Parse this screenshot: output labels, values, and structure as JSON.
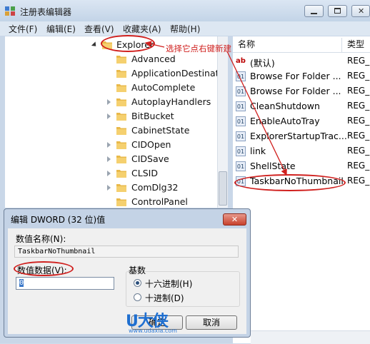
{
  "window": {
    "title": "注册表编辑器"
  },
  "menu": [
    "文件(F)",
    "编辑(E)",
    "查看(V)",
    "收藏夹(A)",
    "帮助(H)"
  ],
  "tree": {
    "selected": "Explorer",
    "items": [
      "Advanced",
      "ApplicationDestinatio",
      "AutoComplete",
      "AutoplayHandlers",
      "BitBucket",
      "CabinetState",
      "CIDOpen",
      "CIDSave",
      "CLSID",
      "ComDlg32",
      "ControlPanel"
    ]
  },
  "values_pane": {
    "columns": {
      "name": "名称",
      "type": "类型"
    },
    "rows": [
      {
        "name": "(默认)",
        "type": "REG_S",
        "icon": "string-value-icon"
      },
      {
        "name": "Browse For Folder ...",
        "type": "REG_D",
        "icon": "binary-value-icon"
      },
      {
        "name": "Browse For Folder ...",
        "type": "REG_D",
        "icon": "binary-value-icon"
      },
      {
        "name": "CleanShutdown",
        "type": "REG_D",
        "icon": "binary-value-icon"
      },
      {
        "name": "EnableAutoTray",
        "type": "REG_D",
        "icon": "binary-value-icon"
      },
      {
        "name": "ExplorerStartupTrac...",
        "type": "REG_D",
        "icon": "binary-value-icon"
      },
      {
        "name": "link",
        "type": "REG_B",
        "icon": "binary-value-icon"
      },
      {
        "name": "ShellState",
        "type": "REG_B",
        "icon": "binary-value-icon"
      },
      {
        "name": "TaskbarNoThumbnail",
        "type": "REG_D",
        "icon": "binary-value-icon"
      }
    ]
  },
  "annotation": "选择它点右键新建",
  "dialog": {
    "title": "编辑 DWORD (32 位)值",
    "name_label": "数值名称(N):",
    "name_value": "TaskbarNoThumbnail",
    "data_label": "数值数据(V):",
    "data_value": "0",
    "base_label": "基数",
    "radio_hex": "十六进制(H)",
    "radio_dec": "十进制(D)",
    "ok_label": "确定",
    "cancel_label": "取消",
    "close_label": "✕"
  },
  "watermark": {
    "logo": "U大侠",
    "url": "www.udaxia.com"
  },
  "colors": {
    "annotation": "#d0201e",
    "accent": "#1f6fd0"
  }
}
